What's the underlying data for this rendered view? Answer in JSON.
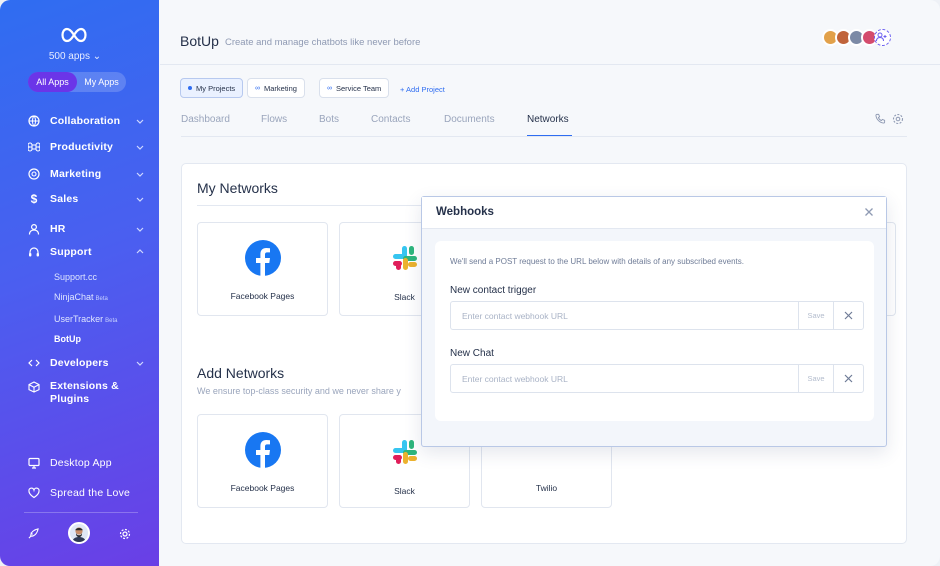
{
  "sidebar": {
    "apps_count": "500 apps",
    "segments": [
      "All Apps",
      "My Apps"
    ],
    "items": [
      {
        "label": "Collaboration",
        "icon": "globe-icon"
      },
      {
        "label": "Productivity",
        "icon": "command-icon"
      },
      {
        "label": "Marketing",
        "icon": "target-icon"
      },
      {
        "label": "Sales",
        "icon": "dollar-icon"
      },
      {
        "label": "HR",
        "icon": "person-icon"
      },
      {
        "label": "Support",
        "icon": "headset-icon"
      },
      {
        "label": "Developers",
        "icon": "code-icon"
      },
      {
        "label": "Extensions & Plugins",
        "icon": "cube-icon"
      }
    ],
    "support_sub": [
      {
        "label": "Support.cc",
        "badge": ""
      },
      {
        "label": "NinjaChat",
        "badge": "Beta"
      },
      {
        "label": "UserTracker",
        "badge": "Beta"
      },
      {
        "label": "BotUp",
        "badge": ""
      }
    ],
    "desktop_app": "Desktop App",
    "spread_love": "Spread the Love"
  },
  "header": {
    "title": "BotUp",
    "subtitle": "Create and manage chatbots like never before"
  },
  "projects": [
    "My Projects",
    "Marketing",
    "Service Team"
  ],
  "add_project": "+ Add Project",
  "tabs": [
    "Dashboard",
    "Flows",
    "Bots",
    "Contacts",
    "Documents",
    "Networks"
  ],
  "active_tab": "Networks",
  "my_networks": {
    "title": "My Networks",
    "cards": [
      "Facebook Pages",
      "Slack"
    ]
  },
  "add_networks": {
    "title": "Add Networks",
    "subtitle": "We ensure top-class security and we never share y",
    "cards": [
      "Facebook Pages",
      "Slack",
      "Twilio"
    ]
  },
  "modal": {
    "title": "Webhooks",
    "info": "We'll send a POST request to the URL below with details of any subscribed events.",
    "fields": [
      {
        "label": "New contact trigger",
        "placeholder": "Enter contact webhook URL",
        "save": "Save"
      },
      {
        "label": "New Chat",
        "placeholder": "Enter contact webhook URL",
        "save": "Save"
      }
    ]
  },
  "colors": {
    "accent": "#2f6df1",
    "sidebar_start": "#2f6df1",
    "sidebar_end": "#6a3fe6",
    "facebook": "#1877f2",
    "twilio": "#e0245e"
  }
}
